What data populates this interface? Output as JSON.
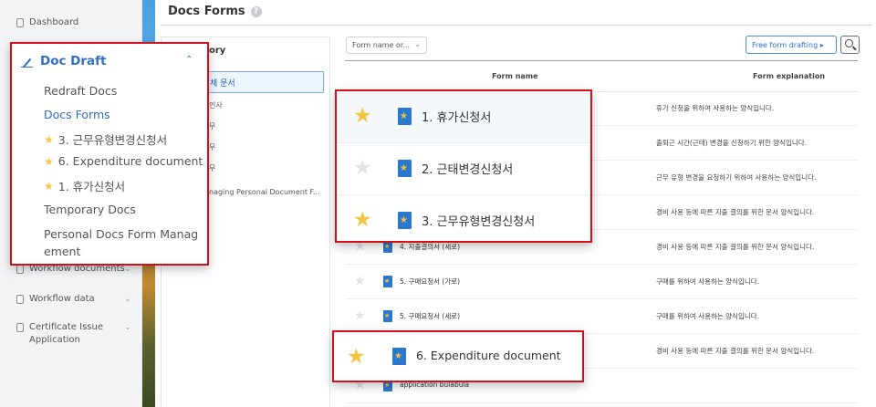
{
  "colors": {
    "accent": "#2f6fc8",
    "callout_border": "#d0111b",
    "star": "#f5c542"
  },
  "leftnav": {
    "dashboard": "Dashboard",
    "workflow_documents": "Workflow documents",
    "workflow_data": "Workflow data",
    "certificate": "Certificate Issue Application"
  },
  "page": {
    "title": "Docs Forms",
    "help": "?"
  },
  "category": {
    "header": "ory",
    "selected": "체 문서",
    "items": [
      "인사",
      "무",
      "무",
      "무",
      "naging Personal Document F..."
    ]
  },
  "toolbar": {
    "select_value": "Form name or...",
    "free_button": "Free form drafting",
    "search_icon": "search-icon"
  },
  "table": {
    "headers": {
      "name": "Form name",
      "desc": "Form explanation"
    },
    "rows": [
      {
        "name": "",
        "desc": "휴가 신청을 위하여 사용하는 양식입니다.",
        "starred": true
      },
      {
        "name": "",
        "desc": "출퇴근 시간(근태) 변경을 신청하기 위한 양식입니다.",
        "starred": false
      },
      {
        "name": "",
        "desc": "근무 유형 변경을 요청하기 위하여 사용하는 양식입니다.",
        "starred": true
      },
      {
        "name": "",
        "desc": "경비 사용 등에 따른 지출 결의를 위한 문서 양식입니다.",
        "starred": false
      },
      {
        "name": "4. 지출결의서 (세로)",
        "desc": "경비 사용 등에 따른 지출 결의를 위한 문서 양식입니다.",
        "starred": false
      },
      {
        "name": "5. 구매요청서 (가로)",
        "desc": "구매를 위하여 사용하는 양식입니다.",
        "starred": false
      },
      {
        "name": "5. 구매요청서 (세로)",
        "desc": "구매를 위하여 사용하는 양식입니다.",
        "starred": false
      },
      {
        "name": "",
        "desc": "경비 사용 등에 따른 지출 결의를 위한 문서 양식입니다.",
        "starred": true
      },
      {
        "name": "application bulabula",
        "desc": "",
        "starred": false
      }
    ]
  },
  "callout_nav": {
    "title": "Doc Draft",
    "items": [
      "Redraft Docs",
      "Docs Forms",
      "3. 근무유형변경신청서",
      "6. Expenditure document",
      "1. 휴가신청서",
      "Temporary Docs"
    ],
    "last": "Personal Docs Form Management"
  },
  "callout_forms": [
    "1. 휴가신청서",
    "2. 근태변경신청서",
    "3. 근무유형변경신청서"
  ],
  "callout_exp": "6. Expenditure document"
}
